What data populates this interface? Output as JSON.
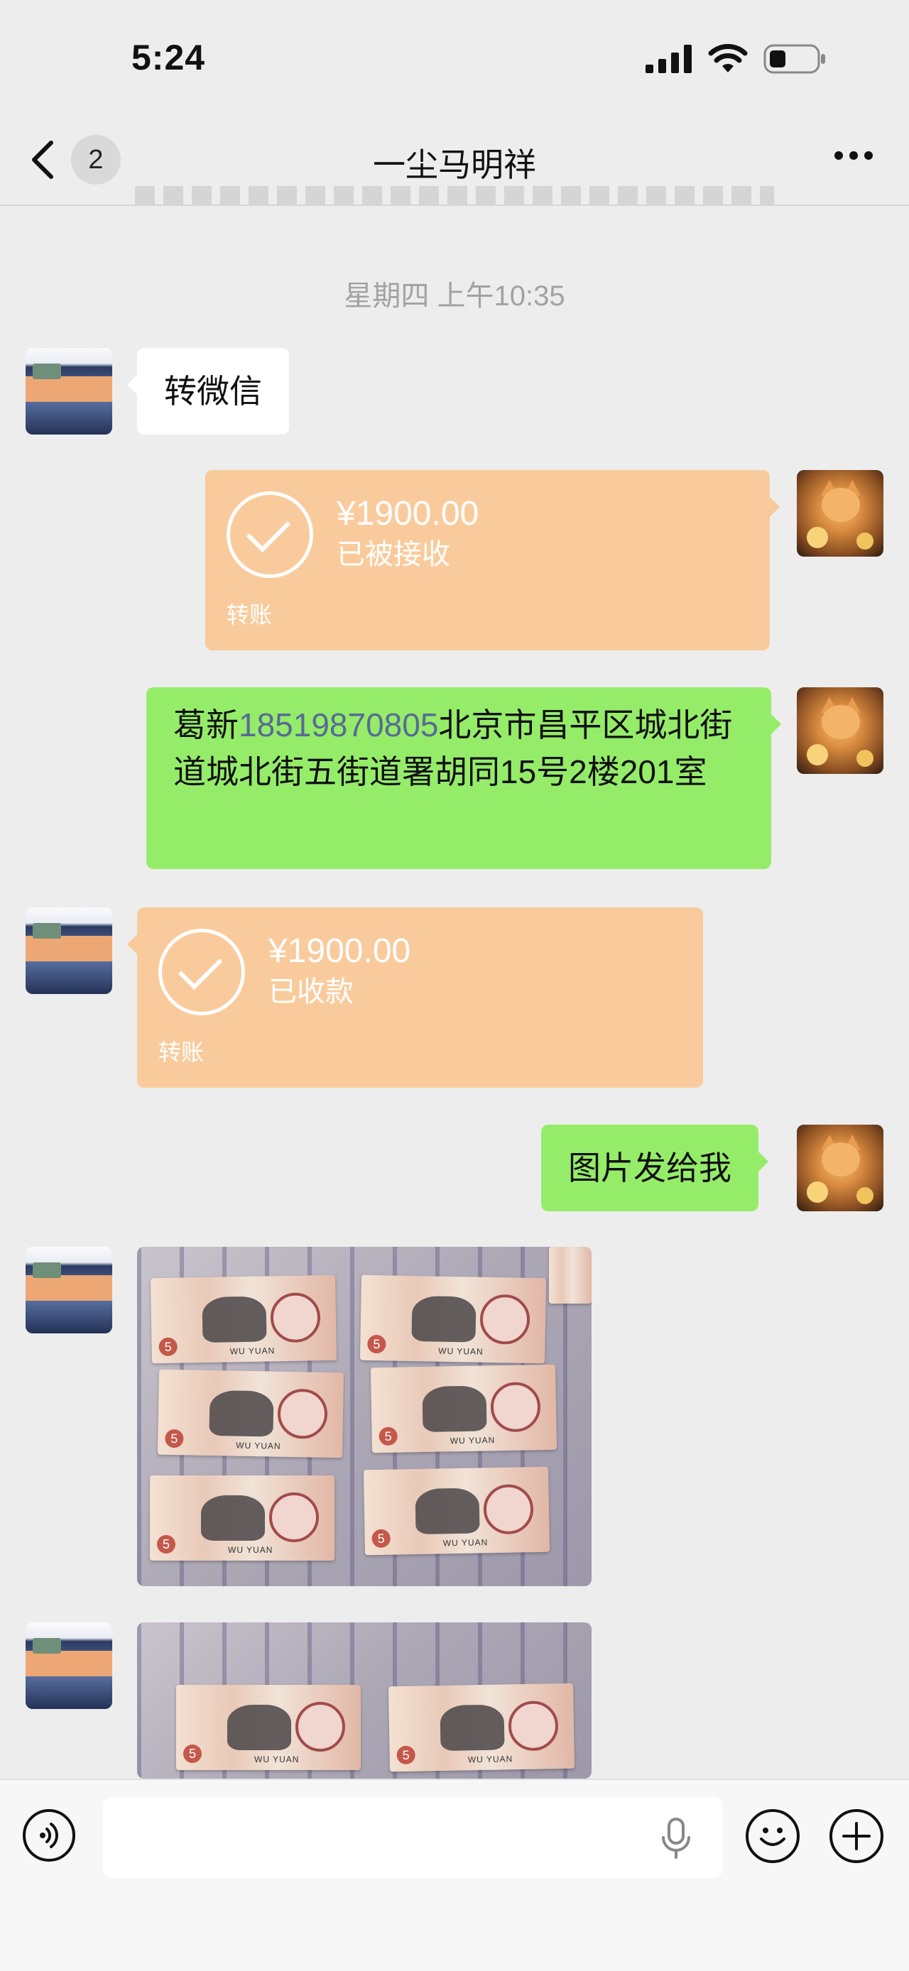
{
  "status_bar": {
    "time": "5:24"
  },
  "header": {
    "back_count": "2",
    "title": "一尘马明祥"
  },
  "timestamp": "星期四 上午10:35",
  "messages": [
    {
      "side": "left",
      "type": "text",
      "text": "转微信"
    },
    {
      "side": "right",
      "type": "transfer",
      "amount": "¥1900.00",
      "status": "已被接收",
      "label": "转账"
    },
    {
      "side": "right",
      "type": "text",
      "text_before": "葛新",
      "phone": "18519870805",
      "text_after": "北京市昌平区城北街道城北街五街道署胡同15号2楼201室"
    },
    {
      "side": "left",
      "type": "transfer",
      "amount": "¥1900.00",
      "status": "已收款",
      "label": "转账"
    },
    {
      "side": "right",
      "type": "text",
      "text": "图片发给我"
    },
    {
      "side": "left",
      "type": "image",
      "description": "banknotes-photo-1"
    },
    {
      "side": "left",
      "type": "image",
      "description": "banknotes-photo-2"
    }
  ],
  "colors": {
    "background": "#ededed",
    "green_bubble": "#95ec69",
    "transfer_bubble": "#f9cb9c",
    "phone_link": "#576b95"
  },
  "icons": {
    "back": "chevron-left-icon",
    "more": "more-icon",
    "voice": "voice-icon",
    "mic": "mic-icon",
    "emoji": "emoji-icon",
    "plus": "plus-icon"
  }
}
